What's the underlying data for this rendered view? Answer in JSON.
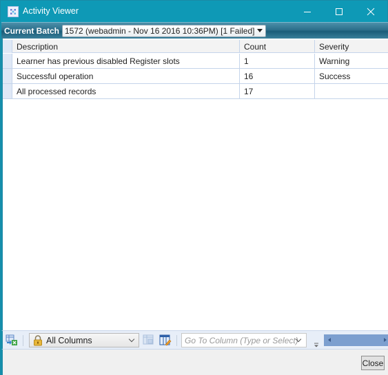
{
  "window": {
    "title": "Activity Viewer",
    "icon": "app-grid-icon",
    "controls": [
      "minimize",
      "maximize",
      "close"
    ]
  },
  "batch": {
    "label": "Current Batch",
    "selected": "1572 (webadmin - Nov 16 2016 10:36PM) [1 Failed]"
  },
  "grid": {
    "columns": [
      "Description",
      "Count",
      "Severity"
    ],
    "rows": [
      {
        "description": "Learner has previous disabled Register slots",
        "count": "1",
        "severity": "Warning"
      },
      {
        "description": "Successful operation",
        "count": "16",
        "severity": "Success"
      },
      {
        "description": "All processed records",
        "count": "17",
        "severity": ""
      }
    ]
  },
  "toolbar": {
    "export_icon": "export-excel-icon",
    "column_filter": {
      "icon": "lock-icon",
      "selected": "All Columns"
    },
    "layout_icon": "grid-layout-icon",
    "edit_columns_icon": "edit-columns-icon",
    "goto_column": {
      "placeholder": "Go To Column (Type or Select)",
      "value": ""
    }
  },
  "footer": {
    "close_label": "Close"
  },
  "colors": {
    "titlebar": "#0e99b6",
    "grid_line": "#c4d4ea",
    "row_indicator": "#dfe8f6",
    "scrollbar": "#7c9fcf"
  }
}
